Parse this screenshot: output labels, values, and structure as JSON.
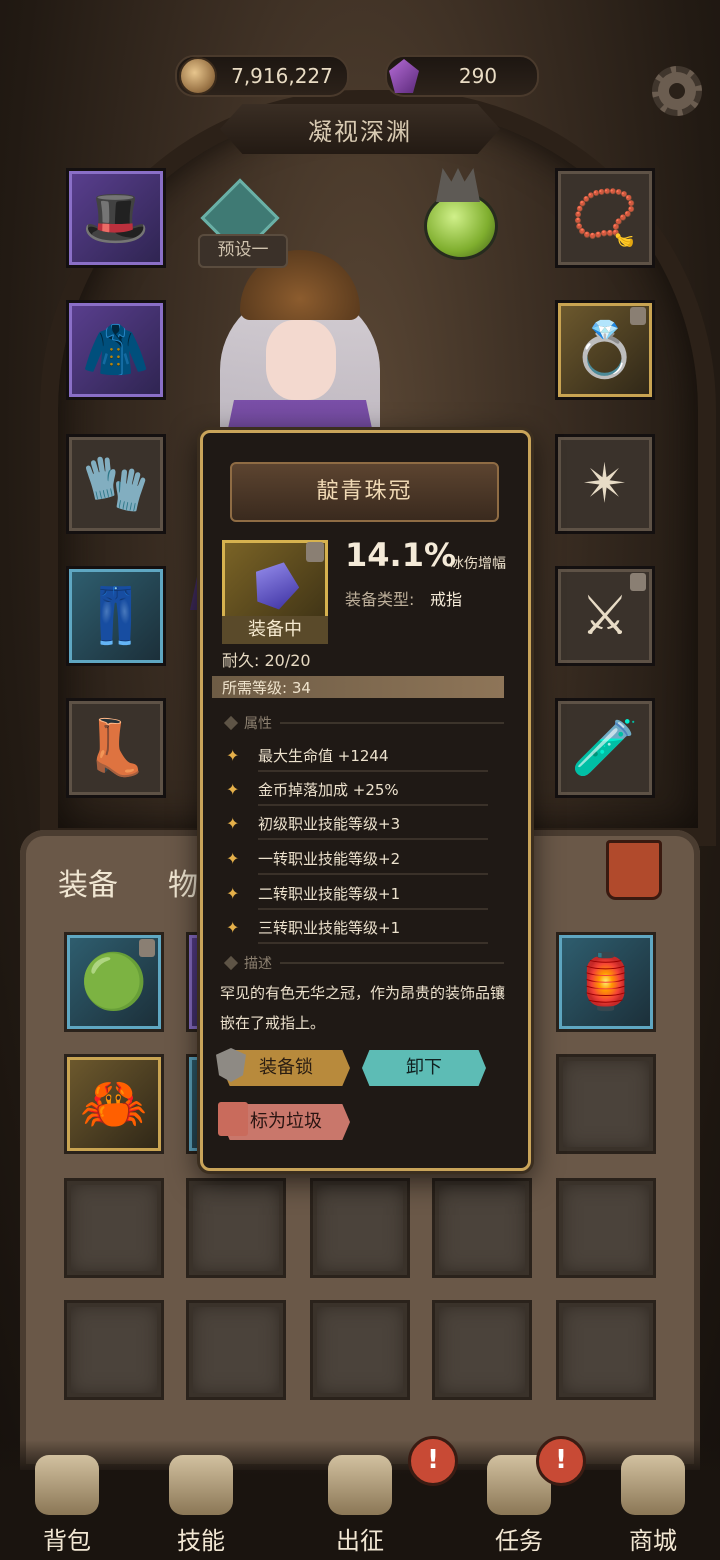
{
  "header": {
    "coins": "7,916,227",
    "gems": "290",
    "stage_title": "凝视深渊"
  },
  "preset": {
    "label": "预设一"
  },
  "tabs": {
    "equipment": "装备",
    "items": "物品"
  },
  "tooltip": {
    "item_name": "靛青珠冠",
    "main_stat_value": "14.1%",
    "main_stat_name": "冰伤增幅",
    "type_label": "装备类型:",
    "type_value": "戒指",
    "equipped_label": "装备中",
    "durability": "耐久: 20/20",
    "requirement": "所需等级: 34",
    "attributes_header": "属性",
    "attributes": [
      "最大生命值 +1244",
      "金币掉落加成 +25%",
      "初级职业技能等级+3",
      "一转职业技能等级+2",
      "二转职业技能等级+1",
      "三转职业技能等级+1"
    ],
    "description_header": "描述",
    "description": "罕见的有色无华之冠，作为昂贵的装饰品镶嵌在了戒指上。",
    "buttons": {
      "lock": "装备锁",
      "unequip": "卸下",
      "mark_trash": "标为垃圾"
    }
  },
  "nav": {
    "bag": "背包",
    "skills": "技能",
    "expedition": "出征",
    "quests": "任务",
    "shop": "商城",
    "alert_mark": "!"
  },
  "icons": {
    "coin": "coin-icon",
    "gem": "gem-icon",
    "settings": "gear-icon",
    "trash": "trash-icon"
  },
  "colors": {
    "gold_frame": "#c9a45a",
    "unequip_button": "#5dbcb5",
    "lock_button": "#b88a3c",
    "trash_button": "#c9776b",
    "alert": "#c84a35"
  }
}
